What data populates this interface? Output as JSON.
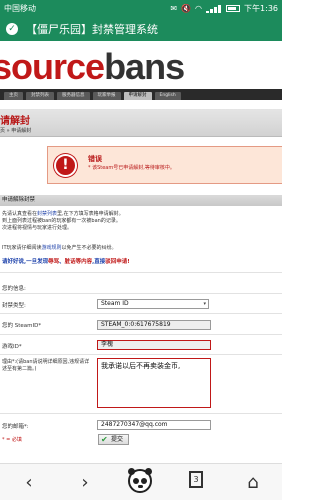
{
  "status_bar": {
    "carrier": "中国移动",
    "time": "下午1:36",
    "battery": "",
    "signal": ""
  },
  "title_bar": {
    "title": "【僵尸乐园】封禁管理系统"
  },
  "logo": {
    "part1": "source",
    "part2": "bans"
  },
  "nav": {
    "tabs": [
      {
        "label": "主页",
        "active": false
      },
      {
        "label": "封禁列表",
        "active": false
      },
      {
        "label": "服务器信息",
        "active": false
      },
      {
        "label": "玩家举报",
        "active": false
      },
      {
        "label": "申请解封",
        "active": true
      },
      {
        "label": "English",
        "active": false
      }
    ]
  },
  "page": {
    "title": "请解封",
    "breadcrumb": "页 » 申请解封"
  },
  "error": {
    "title": "错误",
    "message": "* 该Steam号已申请解封,等待审核中。"
  },
  "section": {
    "heading": "申请解除封禁",
    "intro_line1_a": "先请认真查看在",
    "intro_line1_link": "封禁列表",
    "intro_line1_b": "里,在下方填写表格申请解封。",
    "intro_line2": "到上面列表过程被ban的玩家都有一次被ban的记录。",
    "intro_line3": "次进程将视情与玩家进行处理。",
    "note2_a": "IT玩家请仔细阅读",
    "note2_link": "游戏规则",
    "note2_b": "以免产生不必要的纠纷。",
    "warn_a": "请好好说,一旦发现",
    "warn_red1": "辱骂",
    "warn_b": "、",
    "warn_red2": "脏话等内容",
    "warn_c": ",直接",
    "warn_red3": "驳回申请!"
  },
  "form": {
    "info_label": "您的信息:",
    "ban_type_label": "封禁类型:",
    "ban_type_value": "Steam ID",
    "steamid_label": "您的 SteamID*",
    "steamid_value": "STEAM_0:0:617675819",
    "name_label": "游戏ID*",
    "name_value": "李槐",
    "reason_label": "理由*:(请ban请说明详细原因,违规请详述至有第二篇。)",
    "reason_value": "我承诺以后不再卖装金币,",
    "email_label": "您的邮箱*:",
    "email_value": "2487270347@qq.com",
    "required_note": "* = 必填",
    "submit_label": "提交"
  },
  "bottom_bar": {
    "tab_count": "3"
  }
}
